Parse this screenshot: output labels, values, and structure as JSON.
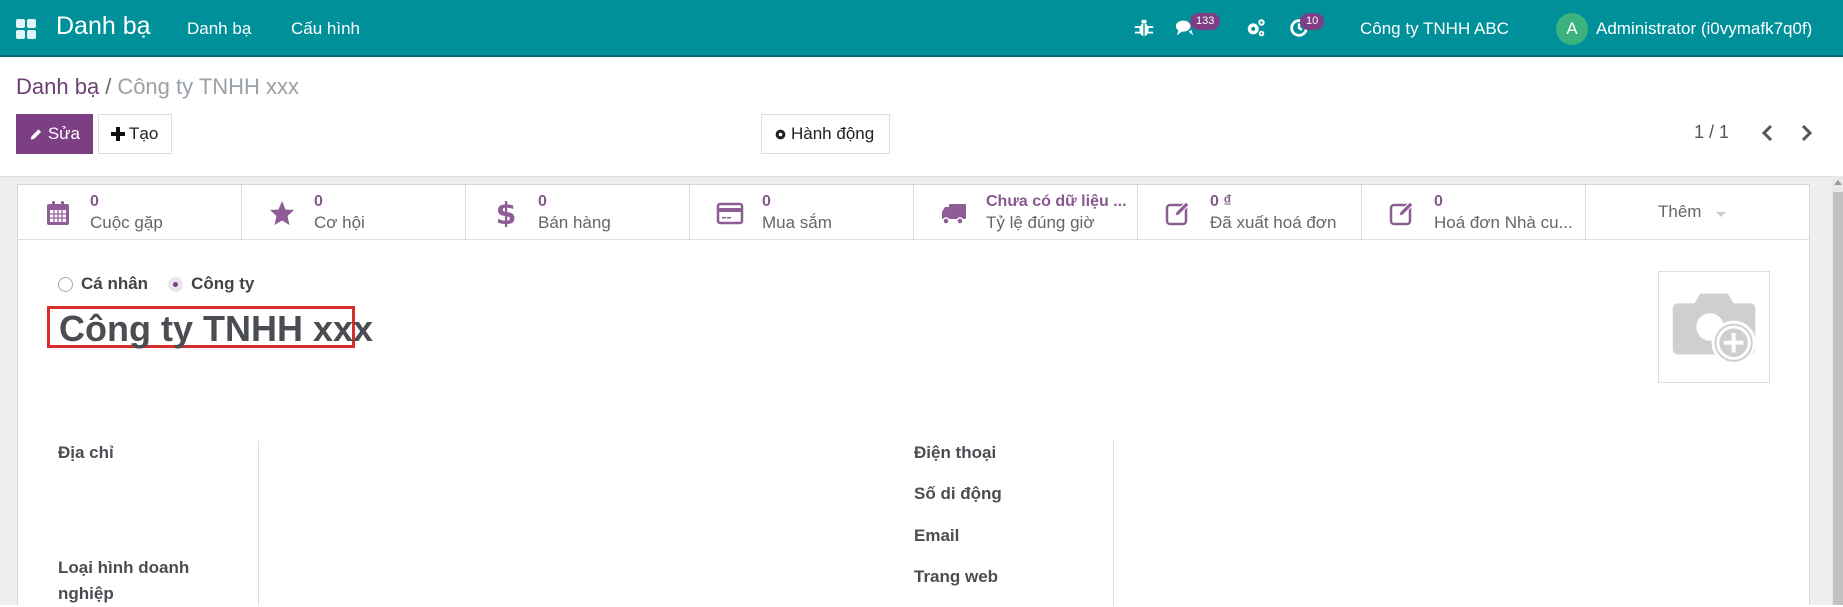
{
  "navbar": {
    "app_title": "Danh bạ",
    "menu": [
      "Danh bạ",
      "Cấu hình"
    ],
    "messages_badge": "133",
    "activities_badge": "10",
    "company": "Công ty TNHH ABC",
    "avatar_letter": "A",
    "user": "Administrator (i0vymafk7q0f)"
  },
  "breadcrumb": {
    "parent": "Danh bạ",
    "separator": "/",
    "current": "Công ty TNHH xxx"
  },
  "toolbar": {
    "edit": "Sửa",
    "create": "Tạo",
    "action": "Hành động"
  },
  "pager": {
    "value": "1 / 1"
  },
  "stat_buttons": [
    {
      "icon": "calendar-icon",
      "value": "0",
      "label": "Cuộc gặp"
    },
    {
      "icon": "star-icon",
      "value": "0",
      "label": "Cơ hội"
    },
    {
      "icon": "dollar-icon",
      "value": "0",
      "label": "Bán hàng"
    },
    {
      "icon": "credit-card-icon",
      "value": "0",
      "label": "Mua sắm"
    },
    {
      "icon": "truck-icon",
      "value": "Chưa có dữ liệu ...",
      "label": "Tỷ lệ đúng giờ"
    },
    {
      "icon": "edit-icon",
      "value": "0 ₫",
      "label": "Đã xuất hoá đơn"
    },
    {
      "icon": "edit-icon",
      "value": "0",
      "label": "Hoá đơn Nhà cu..."
    }
  ],
  "more_button": "Thêm",
  "company_type": {
    "options": [
      "Cá nhân",
      "Công ty"
    ],
    "selected": "Công ty"
  },
  "partner_name": "Công ty TNHH xxx",
  "fields_left": [
    "Địa chỉ",
    "Loại hình doanh nghiệp"
  ],
  "fields_right": [
    "Điện thoại",
    "Số di động",
    "Email",
    "Trang web"
  ],
  "colors": {
    "navbar": "#00909a",
    "primary": "#7c3f84",
    "highlight": "#d62d2d"
  }
}
